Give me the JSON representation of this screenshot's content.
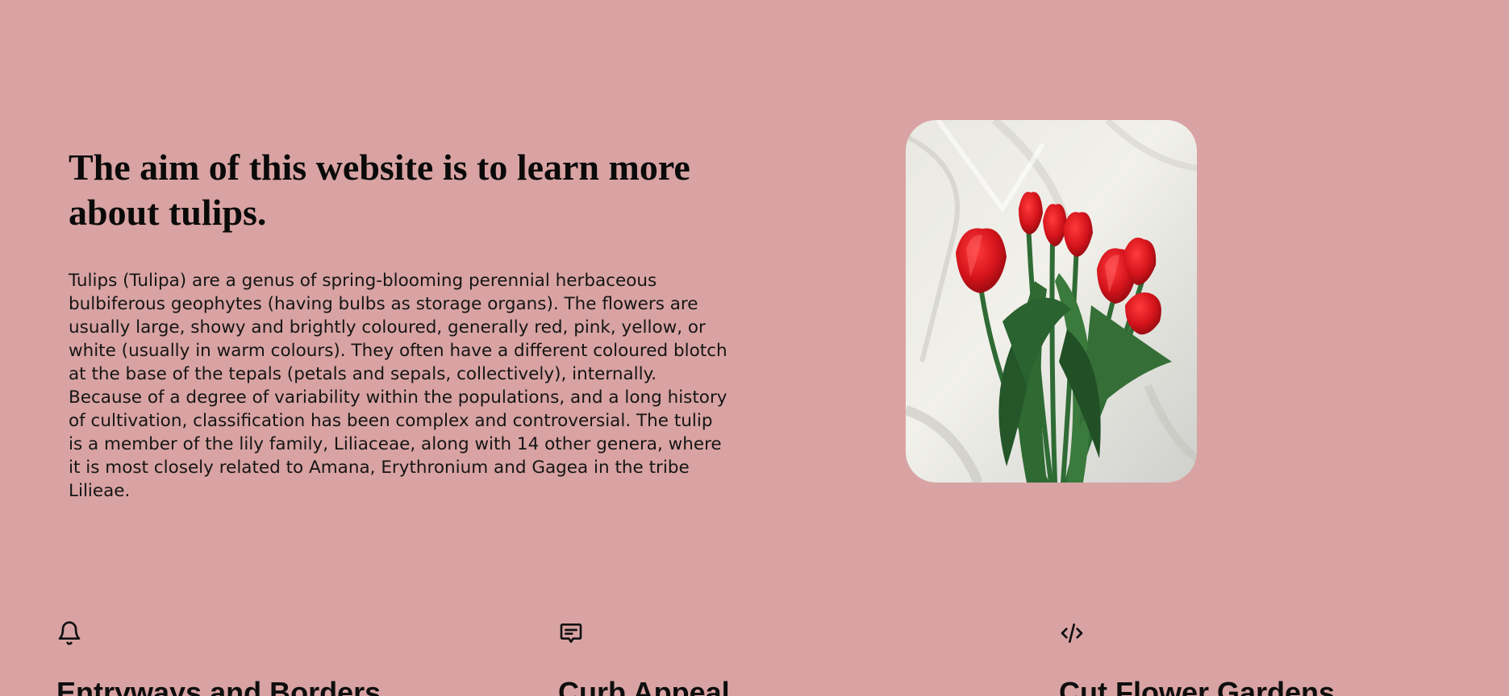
{
  "hero": {
    "title": "The aim of this website is to learn more about tulips.",
    "text": "Tulips (Tulipa) are a genus of spring-blooming perennial herbaceous bulbiferous geophytes (having bulbs as storage organs). The flowers are usually large, showy and brightly coloured, generally red, pink, yellow, or white (usually in warm colours). They often have a different coloured blotch at the base of the tepals (petals and sepals, collectively), internally. Because of a degree of variability within the populations, and a long history of cultivation, classification has been complex and controversial. The tulip is a member of the lily family, Liliaceae, along with 14 other genera, where it is most closely related to Amana, Erythronium and Gagea in the tribe Lilieae.",
    "image": "red-tulips-on-white-sheet-photo"
  },
  "features": [
    {
      "icon": "bell-icon",
      "title": "Entryways and Borders"
    },
    {
      "icon": "message-icon",
      "title": "Curb Appeal"
    },
    {
      "icon": "code-icon",
      "title": "Cut Flower Gardens"
    }
  ],
  "colors": {
    "background": "#d9a3a3",
    "text": "#111111"
  }
}
